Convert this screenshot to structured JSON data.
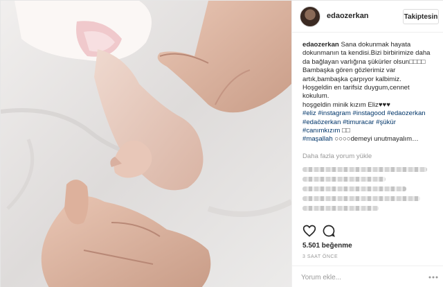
{
  "post": {
    "username": "edaozerkan",
    "follow_label": "Takiptesin",
    "caption": {
      "author": "edaozerkan",
      "lines": [
        " Sana dokunmak hayata",
        "dokunmanın ta kendisi.Bizi birbirimize daha",
        "da bağlayan varlığına şükürler olsun□□□□",
        "Bambaşka gören gözlerimiz var",
        "artık,bambaşka çarpıyor kalbimiz.",
        "Hoşgeldin en tarifsiz duygum,cennet",
        "kokulum.",
        "hoşgeldin minik kızım Eliz♥♥♥"
      ],
      "hashtags_line1": [
        "#eliz",
        "#instagram",
        "#instagood",
        "#edaozerkan"
      ],
      "hashtags_line2": [
        "#edaözerkan",
        "#timuracar",
        "#şükür"
      ],
      "hashtags_line3": [
        "#canımkızım"
      ],
      "line3_suffix": " □□",
      "hashtags_line4": [
        "#maşallah"
      ],
      "line4_suffix": " ○○○○demeyi unutmayalım…"
    },
    "more_comments_label": "Daha fazla yorum yükle",
    "likes_label": "5.501 beğenme",
    "time_label": "3 SAAT ÖNCE",
    "comment_placeholder": "Yorum ekle...",
    "icons": {
      "like": "heart-outline-icon",
      "comment": "speech-bubble-icon",
      "more": "more-dots-icon"
    },
    "colors": {
      "link": "#003569",
      "muted": "#999999",
      "text": "#262626"
    }
  }
}
